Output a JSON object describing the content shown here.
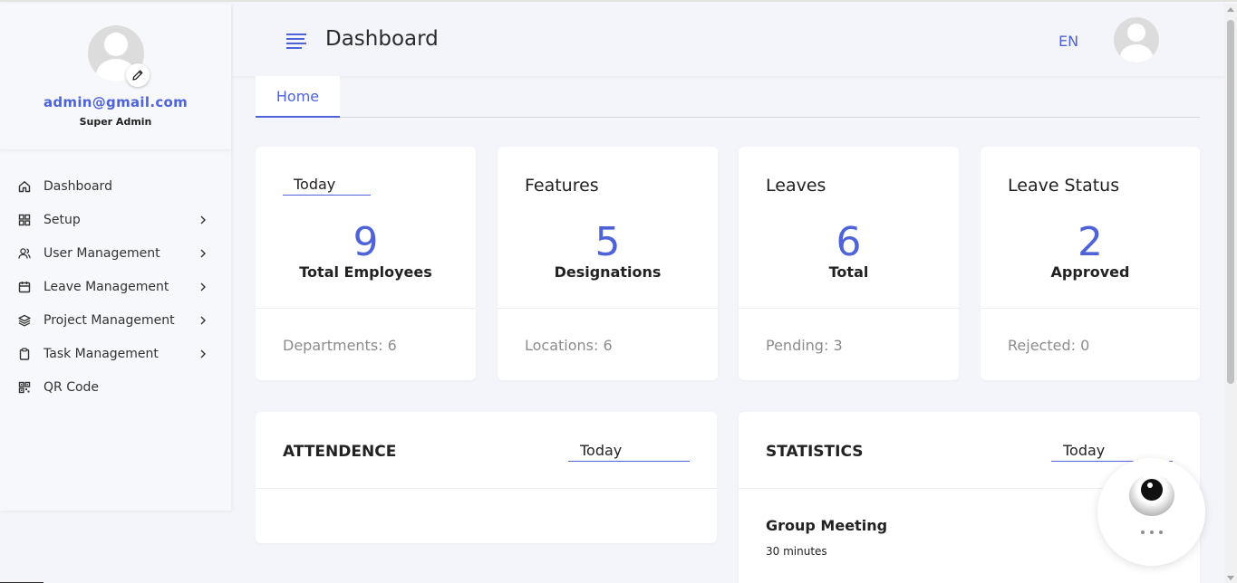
{
  "colors": {
    "accent": "#4f63d9",
    "muted": "#8c8c8c",
    "background": "#f4f5fa"
  },
  "sidebar": {
    "profile": {
      "email": "admin@gmail.com",
      "role": "Super Admin",
      "icon": "edit-pencil-icon"
    },
    "items": [
      {
        "label": "Dashboard",
        "icon": "home-icon",
        "has_children": false
      },
      {
        "label": "Setup",
        "icon": "grid-icon",
        "has_children": true
      },
      {
        "label": "User Management",
        "icon": "users-icon",
        "has_children": true
      },
      {
        "label": "Leave Management",
        "icon": "calendar-icon",
        "has_children": true
      },
      {
        "label": "Project Management",
        "icon": "layers-icon",
        "has_children": true
      },
      {
        "label": "Task Management",
        "icon": "clipboard-icon",
        "has_children": true
      },
      {
        "label": "QR Code",
        "icon": "qr-code-icon",
        "has_children": false
      }
    ]
  },
  "header": {
    "title": "Dashboard",
    "language": "EN"
  },
  "tabs": [
    {
      "label": "Home",
      "active": true
    }
  ],
  "cards": [
    {
      "title": "Today",
      "is_select": true,
      "value": "9",
      "label": "Total Employees",
      "footer": "Departments: 6"
    },
    {
      "title": "Features",
      "is_select": false,
      "value": "5",
      "label": "Designations",
      "footer": "Locations: 6"
    },
    {
      "title": "Leaves",
      "is_select": false,
      "value": "6",
      "label": "Total",
      "footer": "Pending: 3"
    },
    {
      "title": "Leave Status",
      "is_select": false,
      "value": "2",
      "label": "Approved",
      "footer": "Rejected: 0"
    }
  ],
  "attendance": {
    "title": "ATTENDENCE",
    "filter": "Today"
  },
  "statistics": {
    "title": "STATISTICS",
    "filter": "Today",
    "items": [
      {
        "title": "Group Meeting",
        "duration": "30 minutes"
      }
    ]
  }
}
